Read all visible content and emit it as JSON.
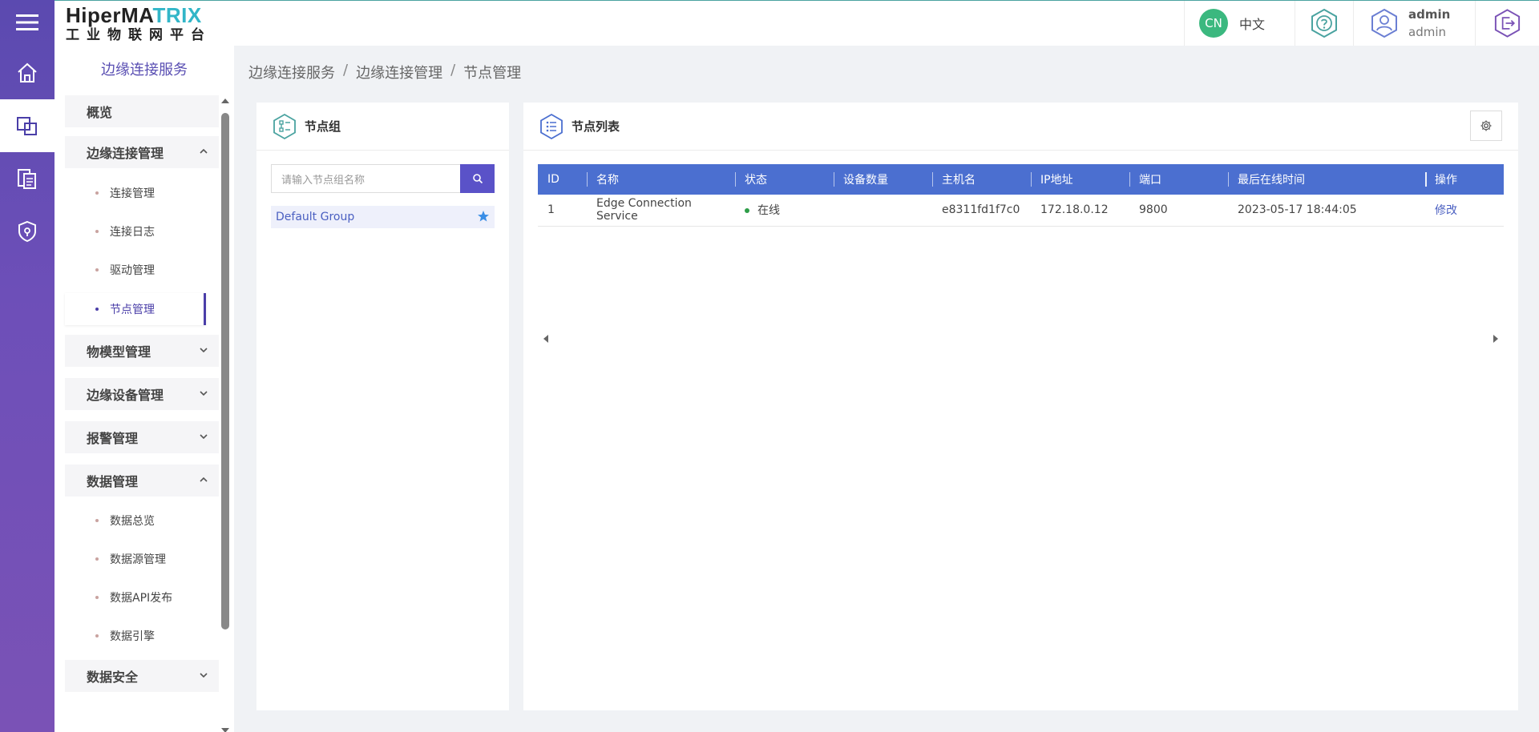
{
  "header": {
    "logo_brand_dark": "HiperMA",
    "logo_brand_light": "TRIX",
    "logo_subtitle": "工业物联网平台",
    "lang_badge": "CN",
    "lang_label": "中文",
    "user_name": "admin",
    "user_role": "admin"
  },
  "sidebar": {
    "title": "边缘连接服务",
    "overview": "概览",
    "group_edge_conn": "边缘连接管理",
    "edge_conn_items": [
      "连接管理",
      "连接日志",
      "驱动管理",
      "节点管理"
    ],
    "group_model": "物模型管理",
    "group_device": "边缘设备管理",
    "group_alarm": "报警管理",
    "group_data": "数据管理",
    "data_items": [
      "数据总览",
      "数据源管理",
      "数据API发布",
      "数据引擎"
    ],
    "group_security": "数据安全"
  },
  "breadcrumb": [
    "边缘连接服务",
    "边缘连接管理",
    "节点管理"
  ],
  "node_group_panel": {
    "title": "节点组",
    "search_placeholder": "请输入节点组名称",
    "groups": [
      "Default Group"
    ]
  },
  "node_list_panel": {
    "title": "节点列表",
    "columns": [
      "ID",
      "名称",
      "状态",
      "设备数量",
      "主机名",
      "IP地址",
      "端口",
      "最后在线时间",
      "操作"
    ],
    "rows": [
      {
        "id": "1",
        "name": "Edge Connection Service",
        "status": "在线",
        "device_count": "",
        "hostname": "e8311fd1f7c0",
        "ip": "172.18.0.12",
        "port": "9800",
        "last_online": "2023-05-17 18:44:05",
        "action": "修改"
      }
    ]
  },
  "colors": {
    "rail_gradient_top": "#5b4ab0",
    "accent": "#4a3ea8",
    "table_header": "#4b6fd0",
    "online": "#2e9d48"
  }
}
